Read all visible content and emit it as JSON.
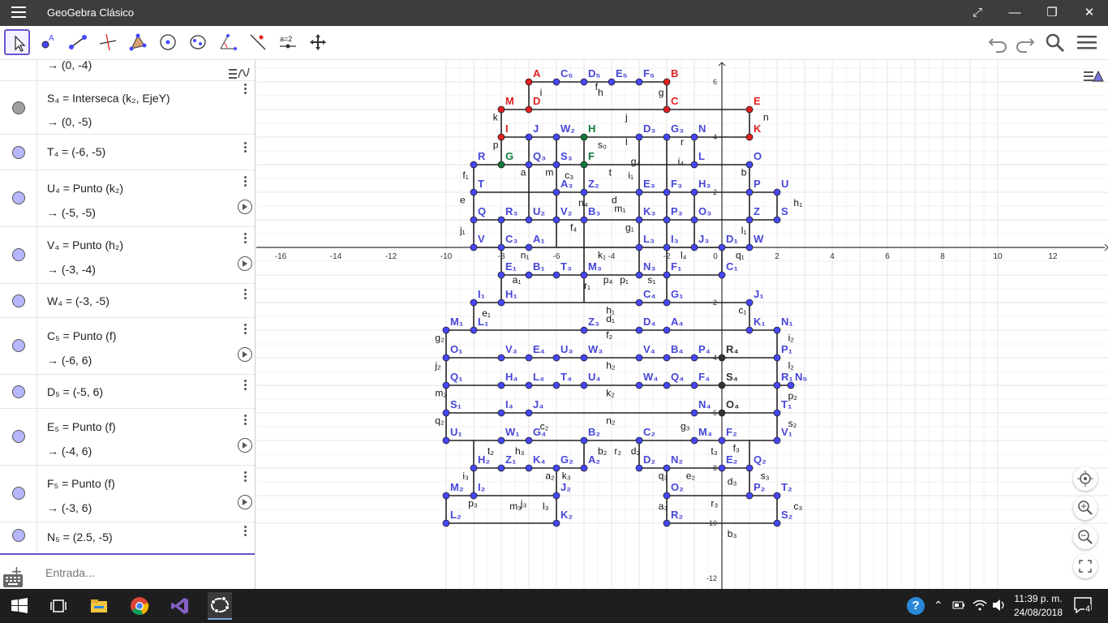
{
  "window": {
    "title": "GeoGebra Clásico",
    "controls": [
      "⤢",
      "—",
      "❐",
      "✕"
    ]
  },
  "toolbar": {
    "tools": [
      "move-tool",
      "point-tool",
      "segment-tool",
      "perpendicular-tool",
      "polygon-tool",
      "circle-tool",
      "conic-tool",
      "angle-tool",
      "reflect-tool",
      "slider-tool",
      "move-graphics-tool"
    ],
    "slider_label": "a=2"
  },
  "algebra": {
    "rows": [
      {
        "def": "",
        "val": "→  (0, -4)",
        "dot": "none"
      },
      {
        "def": "S₄ = Interseca (k₂, EjeY)",
        "val": "→  (0, -5)",
        "dot": "gray"
      },
      {
        "def": "T₄ = (-6, -5)",
        "val": "",
        "dot": "blue"
      },
      {
        "def": "U₄ = Punto (k₂)",
        "val": "→  (-5, -5)",
        "dot": "blue",
        "play": true
      },
      {
        "def": "V₄ = Punto (h₂)",
        "val": "→  (-3, -4)",
        "dot": "blue",
        "play": true
      },
      {
        "def": "W₄ = (-3, -5)",
        "val": "",
        "dot": "blue"
      },
      {
        "def": "C₅ = Punto (f)",
        "val": "→  (-6, 6)",
        "dot": "blue",
        "play": true
      },
      {
        "def": "D₅ = (-5, 6)",
        "val": "",
        "dot": "blue"
      },
      {
        "def": "E₅ = Punto (f)",
        "val": "→  (-4, 6)",
        "dot": "blue",
        "play": true
      },
      {
        "def": "F₅ = Punto (f)",
        "val": "→  (-3, 6)",
        "dot": "blue",
        "play": true
      },
      {
        "def": "N₅ = (2.5, -5)",
        "val": "",
        "dot": "blue"
      }
    ],
    "input_placeholder": "Entrada..."
  },
  "graphics": {
    "x_ticks": [
      "-16",
      "-14",
      "-12",
      "-10",
      "-8",
      "-6",
      "-4",
      "-2",
      "0",
      "2",
      "4",
      "6",
      "8",
      "10",
      "12"
    ],
    "y_ticks": [
      "6",
      "4",
      "2",
      "-2",
      "-4",
      "-6",
      "-8",
      "-10",
      "-12"
    ],
    "colors": {
      "blue_point": "#4646ff",
      "red_point": "#e01f1f",
      "green_point": "#0d7a3a",
      "dark_point": "#333333",
      "grid": "#e6e6e6",
      "axis": "#333333"
    },
    "red_points": [
      [
        "A",
        -7,
        6
      ],
      [
        "B",
        -2,
        6
      ],
      [
        "C",
        -2,
        5
      ],
      [
        "D",
        -7,
        5
      ],
      [
        "M",
        -8,
        5
      ],
      [
        "E",
        1,
        5
      ],
      [
        "I",
        -8,
        4
      ],
      [
        "K",
        1,
        4
      ]
    ],
    "green_points": [
      [
        "G",
        -8,
        3
      ],
      [
        "H",
        -5,
        4
      ],
      [
        "F",
        -5,
        3
      ]
    ],
    "blue_points": [
      [
        "C₅",
        -6,
        6
      ],
      [
        "D₅",
        -5,
        6
      ],
      [
        "E₅",
        -4,
        6
      ],
      [
        "F₅",
        -3,
        6
      ],
      [
        "J",
        -7,
        4
      ],
      [
        "W₂",
        -6,
        4
      ],
      [
        "D₃",
        -3,
        4
      ],
      [
        "G₃",
        -2,
        4
      ],
      [
        "N",
        -1,
        4
      ],
      [
        "R",
        -9,
        3
      ],
      [
        "Q₃",
        -7,
        3
      ],
      [
        "S₃",
        -6,
        3
      ],
      [
        "L",
        -1,
        3
      ],
      [
        "O",
        1,
        3
      ],
      [
        "T",
        -9,
        2
      ],
      [
        "A₃",
        -6,
        2
      ],
      [
        "Z₂",
        -5,
        2
      ],
      [
        "E₃",
        -3,
        2
      ],
      [
        "F₃",
        -2,
        2
      ],
      [
        "H₃",
        -1,
        2
      ],
      [
        "P",
        1,
        2
      ],
      [
        "U",
        2,
        2
      ],
      [
        "Q",
        -9,
        1
      ],
      [
        "R₃",
        -8,
        1
      ],
      [
        "U₂",
        -7,
        1
      ],
      [
        "V₂",
        -6,
        1
      ],
      [
        "B₃",
        -5,
        1
      ],
      [
        "K₃",
        -3,
        1
      ],
      [
        "P₃",
        -2,
        1
      ],
      [
        "O₃",
        -1,
        1
      ],
      [
        "Z",
        1,
        1
      ],
      [
        "S",
        2,
        1
      ],
      [
        "V",
        -9,
        0
      ],
      [
        "C₃",
        -8,
        0
      ],
      [
        "A₁",
        -7,
        0
      ],
      [
        "L₃",
        -3,
        0
      ],
      [
        "I₃",
        -2,
        0
      ],
      [
        "J₃",
        -1,
        0
      ],
      [
        "D₁",
        0,
        0
      ],
      [
        "W",
        1,
        0
      ],
      [
        "E₁",
        -8,
        -1
      ],
      [
        "B₁",
        -7,
        -1
      ],
      [
        "T₃",
        -6,
        -1
      ],
      [
        "M₃",
        -5,
        -1
      ],
      [
        "N₃",
        -3,
        -1
      ],
      [
        "F₁",
        -2,
        -1
      ],
      [
        "C₁",
        0,
        -1
      ],
      [
        "I₁",
        -9,
        -2
      ],
      [
        "H₁",
        -8,
        -2
      ],
      [
        "C₄",
        -3,
        -2
      ],
      [
        "G₁",
        -2,
        -2
      ],
      [
        "J₁",
        1,
        -2
      ],
      [
        "M₁",
        -10,
        -3
      ],
      [
        "L₁",
        -9,
        -3
      ],
      [
        "Z₃",
        -5,
        -3
      ],
      [
        "D₄",
        -3,
        -3
      ],
      [
        "A₄",
        -2,
        -3
      ],
      [
        "K₁",
        1,
        -3
      ],
      [
        "N₁",
        2,
        -3
      ],
      [
        "O₁",
        -10,
        -4
      ],
      [
        "V₃",
        -8,
        -4
      ],
      [
        "E₄",
        -7,
        -4
      ],
      [
        "U₃",
        -6,
        -4
      ],
      [
        "W₃",
        -5,
        -4
      ],
      [
        "V₄",
        -3,
        -4
      ],
      [
        "B₄",
        -2,
        -4
      ],
      [
        "P₄",
        -1,
        -4
      ],
      [
        "P₁",
        2,
        -4
      ],
      [
        "Q₁",
        -10,
        -5
      ],
      [
        "H₄",
        -8,
        -5
      ],
      [
        "L₄",
        -7,
        -5
      ],
      [
        "T₄",
        -6,
        -5
      ],
      [
        "U₄",
        -5,
        -5
      ],
      [
        "W₄",
        -3,
        -5
      ],
      [
        "Q₄",
        -2,
        -5
      ],
      [
        "F₄",
        -1,
        -5
      ],
      [
        "R₁",
        2,
        -5
      ],
      [
        "N₅",
        2.5,
        -5
      ],
      [
        "S₁",
        -10,
        -6
      ],
      [
        "I₄",
        -8,
        -6
      ],
      [
        "J₄",
        -7,
        -6
      ],
      [
        "N₄",
        -1,
        -6
      ],
      [
        "T₁",
        2,
        -6
      ],
      [
        "U₁",
        -10,
        -7
      ],
      [
        "W₁",
        -8,
        -7
      ],
      [
        "G₄",
        -7,
        -7
      ],
      [
        "B₂",
        -5,
        -7
      ],
      [
        "C₂",
        -3,
        -7
      ],
      [
        "M₄",
        -1,
        -7
      ],
      [
        "F₂",
        0,
        -7
      ],
      [
        "V₁",
        2,
        -7
      ],
      [
        "H₂",
        -9,
        -8
      ],
      [
        "Z₁",
        -8,
        -8
      ],
      [
        "K₄",
        -7,
        -8
      ],
      [
        "G₂",
        -6,
        -8
      ],
      [
        "A₂",
        -5,
        -8
      ],
      [
        "D₂",
        -3,
        -8
      ],
      [
        "N₂",
        -2,
        -8
      ],
      [
        "E₂",
        0,
        -8
      ],
      [
        "Q₂",
        1,
        -8
      ],
      [
        "M₂",
        -10,
        -9
      ],
      [
        "I₂",
        -9,
        -9
      ],
      [
        "J₂",
        -6,
        -9
      ],
      [
        "O₂",
        -2,
        -9
      ],
      [
        "P₂",
        1,
        -9
      ],
      [
        "T₂",
        2,
        -9
      ],
      [
        "L₂",
        -10,
        -10
      ],
      [
        "K₂",
        -6,
        -10
      ],
      [
        "R₂",
        -2,
        -10
      ],
      [
        "S₂",
        2,
        -10
      ]
    ],
    "dark_points": [
      [
        "R₄",
        0,
        -4
      ],
      [
        "S₄",
        0,
        -5
      ],
      [
        "O₄",
        0,
        -6
      ]
    ],
    "segment_labels": [
      [
        "i",
        -6.6,
        5.5
      ],
      [
        "j",
        -3.5,
        4.6
      ],
      [
        "f",
        -4.6,
        5.7
      ],
      [
        "h",
        -4.5,
        5.5
      ],
      [
        "g",
        -2.3,
        5.5
      ],
      [
        "k",
        -8.3,
        4.6
      ],
      [
        "n",
        1.5,
        4.6
      ],
      [
        "l",
        -3.5,
        3.7
      ],
      [
        "r",
        -1.5,
        3.7
      ],
      [
        "p",
        -8.3,
        3.6
      ],
      [
        "s₀",
        -4.5,
        3.6
      ],
      [
        "g₄",
        -3.3,
        3.0
      ],
      [
        "i₄",
        -1.6,
        3.0
      ],
      [
        "b",
        0.7,
        2.6
      ],
      [
        "a",
        -7.3,
        2.6
      ],
      [
        "m",
        -6.4,
        2.6
      ],
      [
        "c₃",
        -5.7,
        2.5
      ],
      [
        "t",
        -4.1,
        2.6
      ],
      [
        "i₁",
        -3.4,
        2.5
      ],
      [
        "f₁",
        -9.4,
        2.5
      ],
      [
        "e",
        -9.5,
        1.6
      ],
      [
        "d",
        -4.0,
        1.6
      ],
      [
        "m₁",
        -3.9,
        1.3
      ],
      [
        "n₄",
        -5.2,
        1.5
      ],
      [
        "h₁",
        2.6,
        1.5
      ],
      [
        "g₁",
        -3.5,
        0.6
      ],
      [
        "f₄",
        -5.5,
        0.6
      ],
      [
        "j₁",
        -9.5,
        0.5
      ],
      [
        "l₁",
        0.7,
        0.5
      ],
      [
        "n₁",
        -7.3,
        -0.4
      ],
      [
        "k₁",
        -4.5,
        -0.4
      ],
      [
        "l₄",
        -1.5,
        -0.4
      ],
      [
        "q₁",
        0.5,
        -0.4
      ],
      [
        "a₁",
        -7.6,
        -1.3
      ],
      [
        "r₁",
        -5.0,
        -1.5
      ],
      [
        "p₄",
        -4.3,
        -1.3
      ],
      [
        "p₁",
        -3.7,
        -1.3
      ],
      [
        "s₁",
        -2.7,
        -1.3
      ],
      [
        "e₁",
        -8.7,
        -2.5
      ],
      [
        "h₁",
        -4.2,
        -2.4
      ],
      [
        "d₁",
        -4.2,
        -2.7
      ],
      [
        "c₁",
        0.6,
        -2.4
      ],
      [
        "f₂",
        -4.2,
        -3.3
      ],
      [
        "g₂",
        -10.4,
        -3.4
      ],
      [
        "i₂",
        2.4,
        -3.4
      ],
      [
        "j₂",
        -10.4,
        -4.4
      ],
      [
        "h₂",
        -4.2,
        -4.4
      ],
      [
        "l₂",
        2.4,
        -4.4
      ],
      [
        "k₂",
        -4.2,
        -5.4
      ],
      [
        "m₂",
        -10.4,
        -5.4
      ],
      [
        "p₂",
        2.4,
        -5.5
      ],
      [
        "n₂",
        -4.2,
        -6.4
      ],
      [
        "q₂",
        -10.4,
        -6.4
      ],
      [
        "s₂",
        2.4,
        -6.5
      ],
      [
        "c₂",
        -6.6,
        -6.6
      ],
      [
        "g₃",
        -1.5,
        -6.6
      ],
      [
        "t₂",
        -8.5,
        -7.5
      ],
      [
        "h₃",
        -7.5,
        -7.5
      ],
      [
        "b₂",
        -4.5,
        -7.5
      ],
      [
        "r₂",
        -3.9,
        -7.5
      ],
      [
        "d₂",
        -3.3,
        -7.5
      ],
      [
        "t₃",
        -0.4,
        -7.5
      ],
      [
        "f₃",
        0.4,
        -7.4
      ],
      [
        "i₃",
        -9.4,
        -8.4
      ],
      [
        "a₂",
        -6.4,
        -8.4
      ],
      [
        "k₃",
        -5.8,
        -8.4
      ],
      [
        "q₃",
        -2.3,
        -8.4
      ],
      [
        "e₂",
        -1.3,
        -8.4
      ],
      [
        "d₃",
        0.2,
        -8.6
      ],
      [
        "s₃",
        1.4,
        -8.4
      ],
      [
        "p₃",
        -9.2,
        -9.4
      ],
      [
        "m₃",
        -7.7,
        -9.5
      ],
      [
        "j₃",
        -7.3,
        -9.4
      ],
      [
        "l₃",
        -6.5,
        -9.5
      ],
      [
        "a₃",
        -2.3,
        -9.5
      ],
      [
        "r₃",
        -0.4,
        -9.4
      ],
      [
        "c₃",
        2.6,
        -9.5
      ],
      [
        "b₃",
        0.2,
        -10.5
      ]
    ]
  },
  "taskbar": {
    "time": "11:39 p. m.",
    "date": "24/08/2018",
    "notifications": "4"
  }
}
